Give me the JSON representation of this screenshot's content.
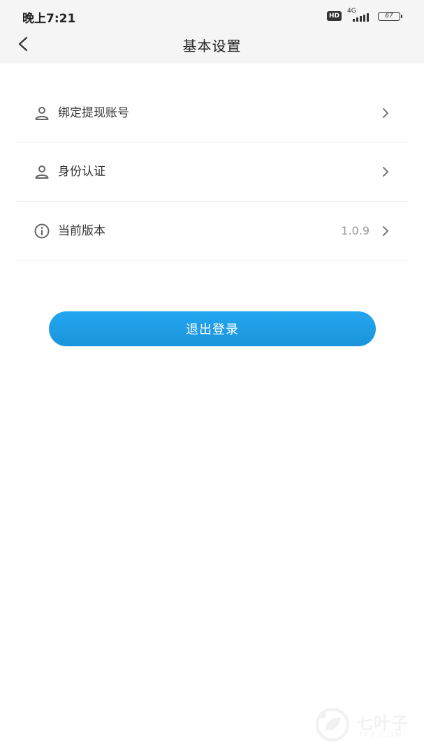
{
  "status_bar": {
    "time": "晚上7:21",
    "hd_badge": "HD",
    "network": "4G",
    "battery": "67"
  },
  "header": {
    "title": "基本设置",
    "back_icon": "chevron-left-icon"
  },
  "settings": [
    {
      "label": "绑定提现账号",
      "value": "",
      "icon": "person-icon"
    },
    {
      "label": "身份认证",
      "value": "",
      "icon": "person-icon"
    },
    {
      "label": "当前版本",
      "value": "1.0.9",
      "icon": "info-icon"
    }
  ],
  "logout_button": {
    "label": "退出登录",
    "color": "#1e9fe8"
  },
  "watermark": {
    "name": "七叶子",
    "url": "7YZ.COM"
  },
  "colors": {
    "header_bg": "#f5f5f5",
    "divider": "#eeeeee",
    "accent": "#1e9fe8"
  }
}
